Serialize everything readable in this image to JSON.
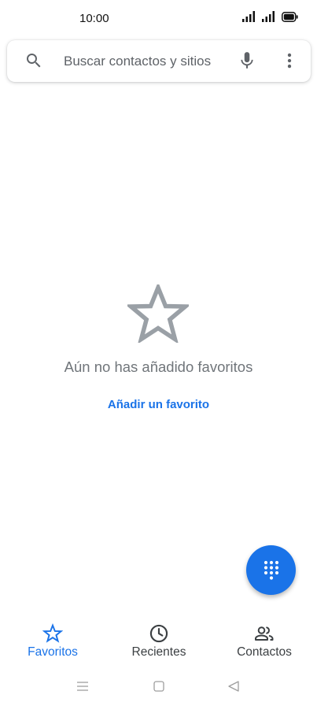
{
  "status_bar": {
    "time": "10:00",
    "icons": [
      "signal-icon",
      "signal-icon",
      "battery-icon"
    ]
  },
  "search": {
    "placeholder": "Buscar contactos y sitios",
    "value": "",
    "icons": [
      "search-icon",
      "mic-icon",
      "more-vert-icon"
    ]
  },
  "empty_state": {
    "icon": "star-outline-icon",
    "message": "Aún no has añadido favoritos",
    "action_label": "Añadir un favorito"
  },
  "fab": {
    "icon": "dialpad-icon"
  },
  "bottom_nav": {
    "items": [
      {
        "label": "Favoritos",
        "icon": "star-outline-icon",
        "selected": true
      },
      {
        "label": "Recientes",
        "icon": "clock-icon",
        "selected": false
      },
      {
        "label": "Contactos",
        "icon": "people-icon",
        "selected": false
      }
    ]
  },
  "system_nav": {
    "icons": [
      "menu-icon",
      "home-square-icon",
      "back-triangle-icon"
    ]
  },
  "colors": {
    "accent": "#1a73e8",
    "icon_grey": "#5f6368",
    "empty_text": "#70757a",
    "star_grey": "#9aa0a6"
  }
}
